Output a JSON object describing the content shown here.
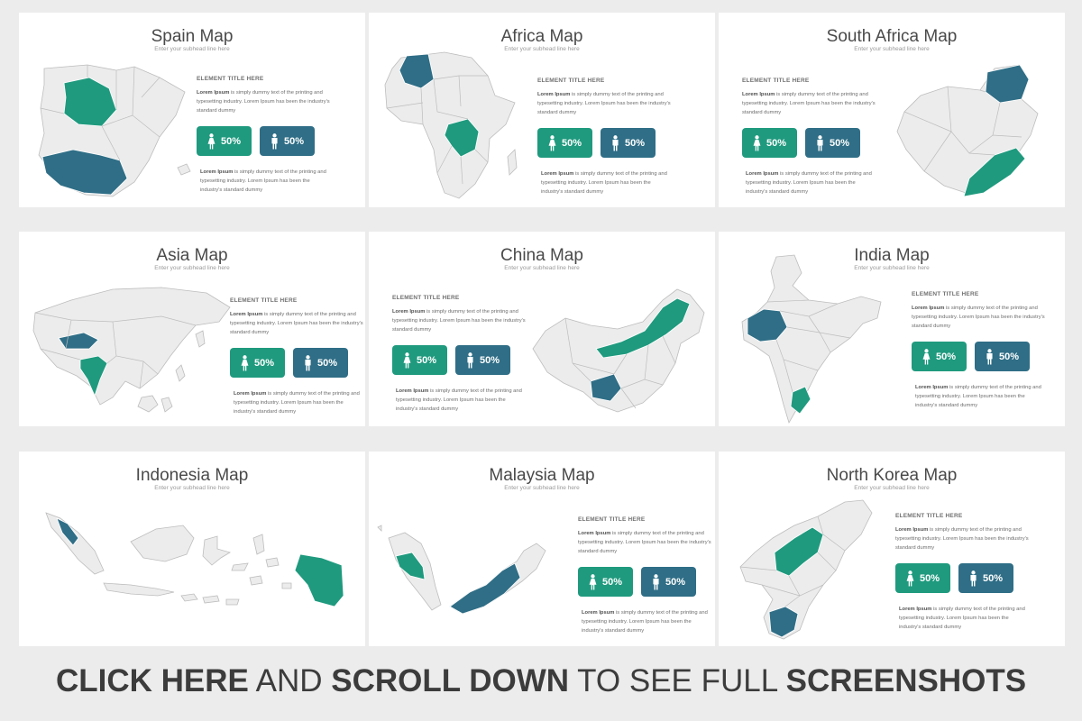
{
  "colors": {
    "green": "#1f9a7e",
    "blue": "#2f6e86",
    "land": "#ececec",
    "border": "#bdbdbd"
  },
  "slides": [
    {
      "title": "Spain Map",
      "subtitle": "Enter your subhead line here",
      "element_title": "ELEMENT TITLE HERE",
      "para1_bold": "Lorem Ipsum",
      "para1": " is simply dummy text of the printing and typesetting industry. Lorem Ipsum has been the industry's standard dummy",
      "btn_female": "50%",
      "btn_male": "50%",
      "para2_bold": "Lorem Ipsum",
      "para2": " is simply dummy text of the printing and typesetting industry. Lorem Ipsum has been the industry's standard dummy"
    },
    {
      "title": "Africa Map",
      "subtitle": "Enter your subhead line here",
      "element_title": "ELEMENT TITLE HERE",
      "para1_bold": "Lorem Ipsum",
      "para1": " is simply dummy text of the printing and typesetting industry. Lorem Ipsum has been the industry's standard dummy",
      "btn_female": "50%",
      "btn_male": "50%",
      "para2_bold": "Lorem Ipsum",
      "para2": " is simply dummy text of the printing and typesetting industry. Lorem Ipsum has been the industry's standard dummy"
    },
    {
      "title": "South Africa Map",
      "subtitle": "Enter your subhead line here",
      "element_title": "ELEMENT TITLE HERE",
      "para1_bold": "Lorem Ipsum",
      "para1": " is simply dummy text of the printing and typesetting industry. Lorem Ipsum has been the industry's standard dummy",
      "btn_female": "50%",
      "btn_male": "50%",
      "para2_bold": "Lorem Ipsum",
      "para2": " is simply dummy text of the printing and typesetting industry. Lorem Ipsum has been the industry's standard dummy"
    },
    {
      "title": "Asia Map",
      "subtitle": "Enter your subhead line here",
      "element_title": "ELEMENT TITLE HERE",
      "para1_bold": "Lorem Ipsum",
      "para1": " is simply dummy text of the printing and typesetting industry. Lorem Ipsum has been the industry's standard dummy",
      "btn_female": "50%",
      "btn_male": "50%",
      "para2_bold": "Lorem Ipsum",
      "para2": " is simply dummy text of the printing and typesetting industry. Lorem Ipsum has been the industry's standard dummy"
    },
    {
      "title": "China Map",
      "subtitle": "Enter your subhead line here",
      "element_title": "ELEMENT TITLE HERE",
      "para1_bold": "Lorem Ipsum",
      "para1": " is simply dummy text of the printing and typesetting industry. Lorem Ipsum has been the industry's standard dummy",
      "btn_female": "50%",
      "btn_male": "50%",
      "para2_bold": "Lorem Ipsum",
      "para2": " is simply dummy text of the printing and typesetting industry. Lorem Ipsum has been the industry's standard dummy"
    },
    {
      "title": "India Map",
      "subtitle": "Enter your subhead line here",
      "element_title": "ELEMENT TITLE HERE",
      "para1_bold": "Lorem Ipsum",
      "para1": " is simply dummy text of the printing and typesetting industry. Lorem Ipsum has been the industry's standard dummy",
      "btn_female": "50%",
      "btn_male": "50%",
      "para2_bold": "Lorem Ipsum",
      "para2": " is simply dummy text of the printing and typesetting industry. Lorem Ipsum has been the industry's standard dummy"
    },
    {
      "title": "Indonesia Map",
      "subtitle": "Enter your subhead line here"
    },
    {
      "title": "Malaysia Map",
      "subtitle": "Enter your subhead line here",
      "element_title": "ELEMENT TITLE HERE",
      "para1_bold": "Lorem Ipsum",
      "para1": " is simply dummy text of the printing and typesetting industry. Lorem Ipsum has been the industry's standard dummy",
      "btn_female": "50%",
      "btn_male": "50%",
      "para2_bold": "Lorem Ipsum",
      "para2": " is simply dummy text of the printing and typesetting industry. Lorem Ipsum has been the industry's standard dummy"
    },
    {
      "title": "North Korea Map",
      "subtitle": "Enter your subhead line here",
      "element_title": "ELEMENT TITLE HERE",
      "para1_bold": "Lorem Ipsum",
      "para1": " is simply dummy text of the printing and typesetting industry. Lorem Ipsum has been the industry's standard dummy",
      "btn_female": "50%",
      "btn_male": "50%",
      "para2_bold": "Lorem Ipsum",
      "para2": " is simply dummy text of the printing and typesetting industry. Lorem Ipsum has been the industry's standard dummy"
    }
  ],
  "banner": {
    "part1": "CLICK HERE",
    "part2": " AND ",
    "part3": "SCROLL DOWN",
    "part4": " TO SEE FULL ",
    "part5": "SCREENSHOTS"
  },
  "icons": {
    "female": "female-person-icon",
    "male": "male-person-icon"
  }
}
